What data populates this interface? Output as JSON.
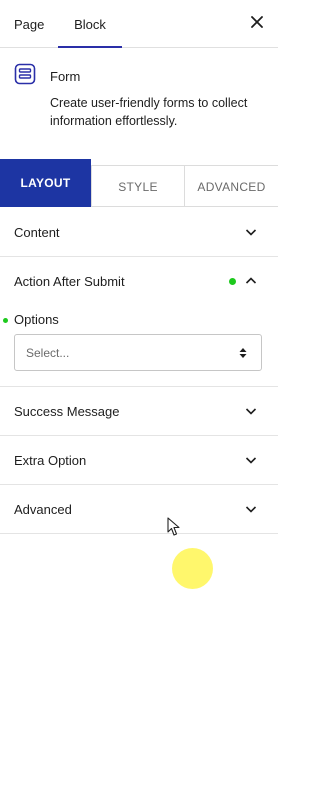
{
  "top_tabs": {
    "page": "Page",
    "block": "Block"
  },
  "block": {
    "name": "Form",
    "description": "Create user-friendly forms to collect information effortlessly.",
    "icon": "form-icon"
  },
  "section_tabs": {
    "layout": "LAYOUT",
    "style": "STYLE",
    "advanced": "ADVANCED"
  },
  "panels": {
    "content": "Content",
    "action_after_submit": "Action After Submit",
    "success_message": "Success Message",
    "extra_option": "Extra Option",
    "advanced": "Advanced"
  },
  "options": {
    "label": "Options",
    "select_value": "Select..."
  },
  "colors": {
    "accent": "#1d35a3",
    "status_dot": "#1dc91d",
    "click_indicator": "#fff65c"
  }
}
